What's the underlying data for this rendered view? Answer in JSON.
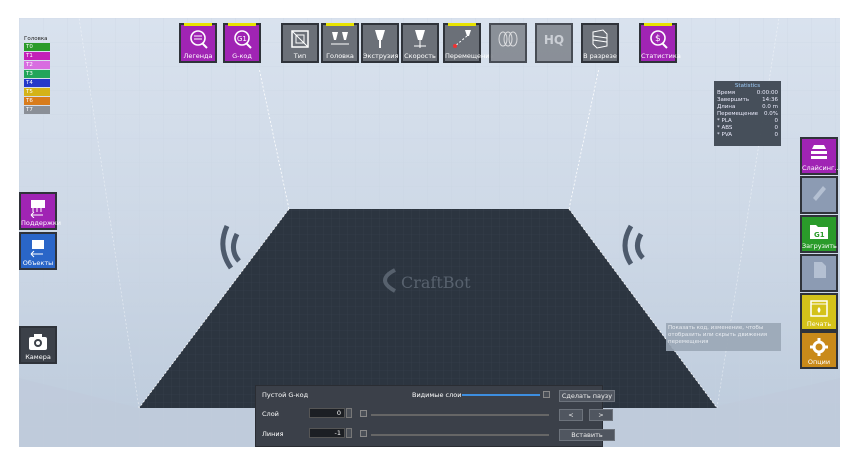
{
  "toolbar": {
    "legend": "Легенда",
    "gcode": "G-код",
    "type": "Тип",
    "head": "Головка",
    "extrusion": "Экструзия",
    "speed": "Скорость",
    "travel": "Перемещение",
    "hq": "HQ",
    "section": "В разрезе",
    "stats": "Статистика"
  },
  "legend": {
    "title": "Головка",
    "items": [
      {
        "label": "T0",
        "color": "#2a9b2a"
      },
      {
        "label": "T1",
        "color": "#c321b8"
      },
      {
        "label": "T2",
        "color": "#d86de0"
      },
      {
        "label": "T3",
        "color": "#22a55a"
      },
      {
        "label": "T4",
        "color": "#2439c8"
      },
      {
        "label": "T5",
        "color": "#d4b318"
      },
      {
        "label": "T6",
        "color": "#d87c1c"
      },
      {
        "label": "T7",
        "color": "#8a8f97"
      }
    ]
  },
  "statistics": {
    "title": "Statistics",
    "rows": [
      {
        "label": "Время",
        "value": "0:00:00"
      },
      {
        "label": "Завершить",
        "value": "14:36"
      },
      {
        "label": "Длина",
        "value": "0.0 m"
      },
      {
        "label": "Перемещение",
        "value": "0.0%"
      },
      {
        "label": "* PLA",
        "value": "0"
      },
      {
        "label": "* ABS",
        "value": "0"
      },
      {
        "label": "* PVA",
        "value": "0"
      }
    ]
  },
  "left_panel": {
    "supports": "Поддержки",
    "objects": "Объекты",
    "camera": "Камера"
  },
  "right_panel": {
    "slicing": "Слайсинг...",
    "upload": "Загрузить",
    "print": "Печать",
    "options": "Опции"
  },
  "tooltip": "Показать код, изменение, чтобы отобразить или скрыть движения перемещения",
  "bottom_panel": {
    "title": "Пустой G-код",
    "visible_layers": "Видимые слои",
    "layer_label": "Слой",
    "layer_value": "0",
    "line_label": "Линия",
    "line_value": "-1",
    "pause_button": "Сделать паузу",
    "prev": "<",
    "next": ">",
    "insert_button": "Вставить"
  },
  "watermark": {
    "brand": "CraftBot"
  },
  "colors": {
    "purple": "#a024b4",
    "green": "#2a9b2a",
    "yellow": "#d4c21a",
    "orange": "#c98a1a",
    "blue": "#2a66c8",
    "active": "#e8e300"
  }
}
